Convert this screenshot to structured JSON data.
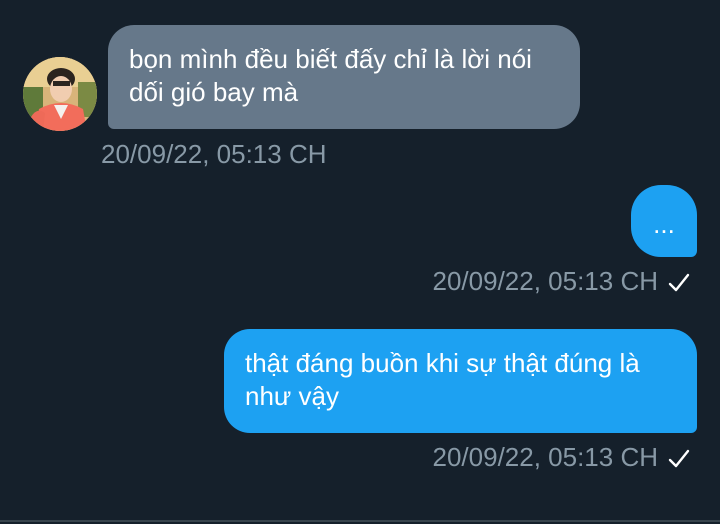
{
  "messages": [
    {
      "direction": "incoming",
      "text": "bọn mình đều biết đấy chỉ là lời nói dối gió bay mà",
      "timestamp": "20/09/22, 05:13 CH"
    },
    {
      "direction": "outgoing",
      "text": "...",
      "timestamp": "20/09/22, 05:13 CH",
      "status_icon": "check-icon"
    },
    {
      "direction": "outgoing",
      "text": "thật đáng buồn khi sự thật đúng là như vậy",
      "timestamp": "20/09/22, 05:13 CH",
      "status_icon": "check-icon"
    }
  ],
  "colors": {
    "background": "#15202b",
    "incoming_bubble": "#66788a",
    "outgoing_bubble": "#1da1f2",
    "timestamp": "#8899a6",
    "text": "#ffffff"
  }
}
